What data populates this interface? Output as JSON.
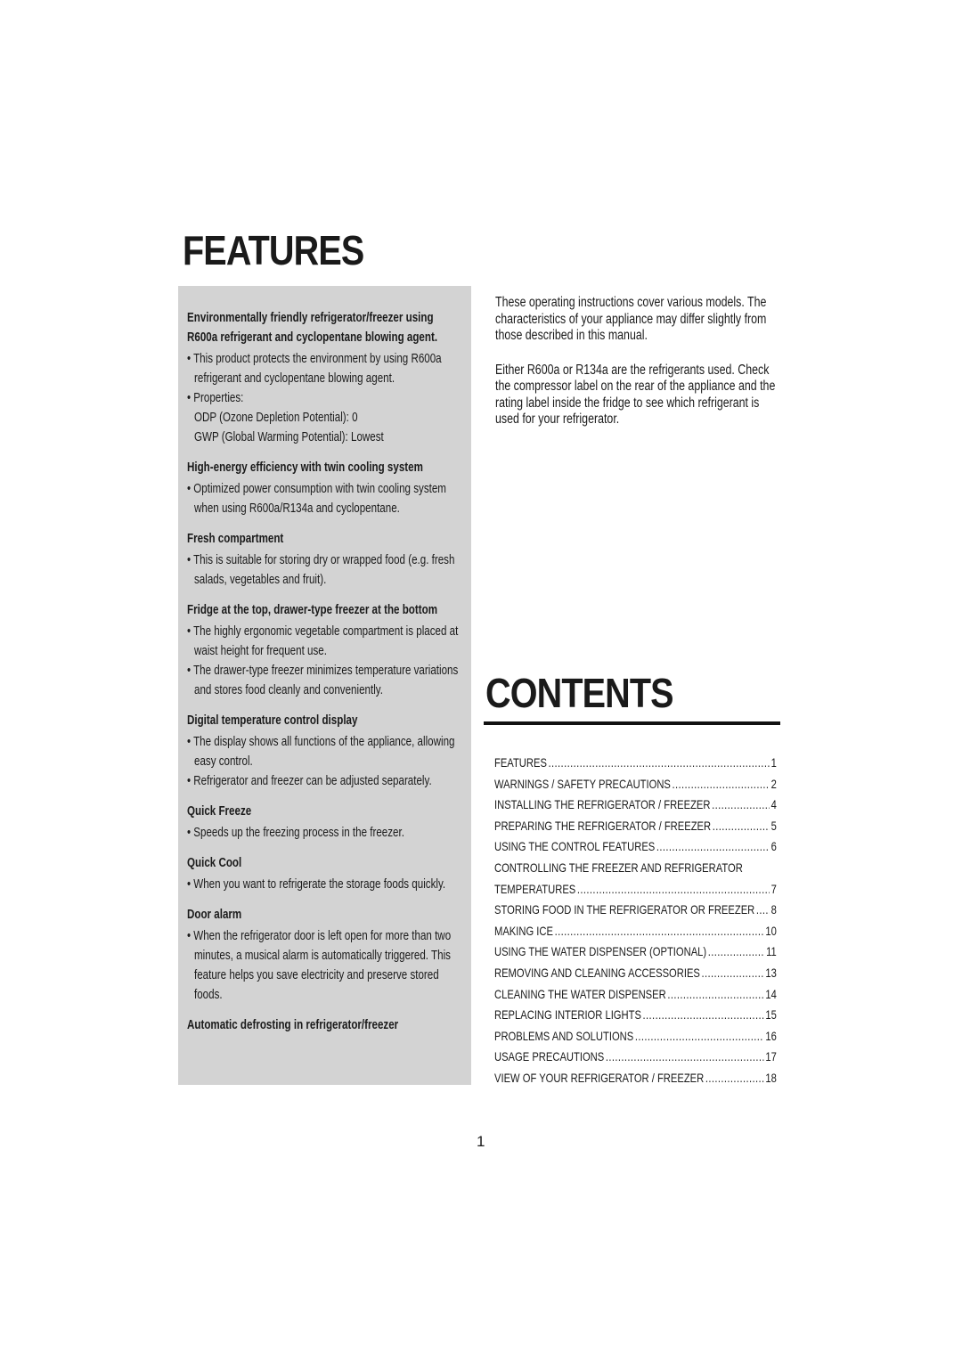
{
  "features_title": "FEATURES",
  "contents_title": "CONTENTS",
  "features_box": [
    {
      "heading": "Environmentally friendly refrigerator/freezer using R600a refrigerant and cyclopentane blowing agent.",
      "items": [
        "• This product protects the environment by using R600a refrigerant and cyclopentane blowing agent.",
        "• Properties:"
      ],
      "plain": [
        "ODP (Ozone Depletion Potential): 0",
        "GWP (Global Warming Potential): Lowest"
      ]
    },
    {
      "heading": "High-energy efficiency with twin cooling system",
      "items": [
        "• Optimized power consumption with twin cooling system when using R600a/R134a and cyclopentane."
      ]
    },
    {
      "heading": "Fresh compartment",
      "items": [
        "• This is suitable for storing dry or wrapped food (e.g. fresh salads, vegetables and fruit)."
      ]
    },
    {
      "heading": "Fridge at the top, drawer-type freezer at the bottom",
      "items": [
        "• The highly ergonomic vegetable compartment is placed at waist height for frequent use.",
        "• The drawer-type freezer minimizes temperature variations and stores food cleanly and conveniently."
      ]
    },
    {
      "heading": "Digital temperature control display",
      "items": [
        "• The display shows all functions of the appliance, allowing easy control.",
        "• Refrigerator and freezer can be adjusted separately."
      ]
    },
    {
      "heading": "Quick Freeze",
      "items": [
        "• Speeds up the freezing process in the freezer."
      ]
    },
    {
      "heading": "Quick Cool",
      "items": [
        "• When you want to refrigerate the storage foods quickly."
      ]
    },
    {
      "heading": "Door alarm",
      "items": [
        "• When the refrigerator door is left open for more than two minutes, a musical alarm is automatically triggered. This feature helps you save electricity and preserve stored foods."
      ]
    },
    {
      "heading": "Automatic defrosting in refrigerator/freezer",
      "items": []
    }
  ],
  "intro": [
    "These operating instructions cover various models. The characteristics of your appliance may differ slightly from those described in this manual.",
    "Either R600a or R134a are the refrigerants used. Check the compressor label on the rear of the appliance and the rating label inside the fridge to see which refrigerant is used for your refrigerator."
  ],
  "toc": [
    {
      "label": "FEATURES",
      "page": "1"
    },
    {
      "label": "WARNINGS / SAFETY PRECAUTIONS",
      "page": "2"
    },
    {
      "label": "INSTALLING THE REFRIGERATOR / FREEZER",
      "page": "4"
    },
    {
      "label": "PREPARING THE REFRIGERATOR / FREEZER",
      "page": "5"
    },
    {
      "label": "USING THE CONTROL FEATURES",
      "page": "6"
    },
    {
      "label": "CONTROLLING THE FREEZER AND REFRIGERATOR",
      "page": ""
    },
    {
      "label": "TEMPERATURES",
      "page": "7"
    },
    {
      "label": "STORING FOOD IN THE REFRIGERATOR OR FREEZER",
      "page": "8"
    },
    {
      "label": "MAKING ICE",
      "page": "10"
    },
    {
      "label": "USING THE WATER DISPENSER (OPTIONAL)",
      "page": "11"
    },
    {
      "label": "REMOVING AND CLEANING ACCESSORIES",
      "page": "13"
    },
    {
      "label": "CLEANING THE WATER DISPENSER",
      "page": "14"
    },
    {
      "label": "REPLACING INTERIOR LIGHTS",
      "page": "15"
    },
    {
      "label": "PROBLEMS AND SOLUTIONS",
      "page": "16"
    },
    {
      "label": "USAGE PRECAUTIONS",
      "page": "17"
    },
    {
      "label": "VIEW OF YOUR REFRIGERATOR / FREEZER",
      "page": "18"
    }
  ],
  "page_number": "1"
}
